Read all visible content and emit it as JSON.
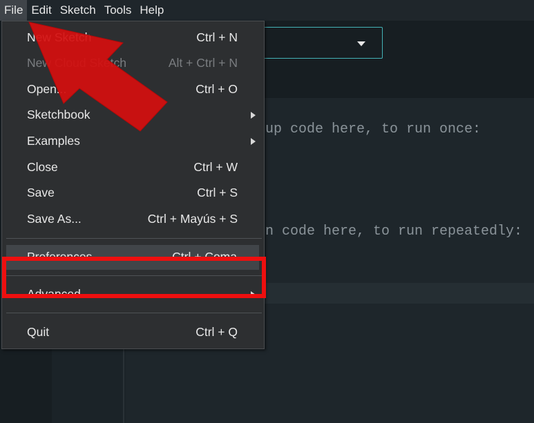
{
  "menubar": {
    "items": [
      "File",
      "Edit",
      "Sketch",
      "Tools",
      "Help"
    ]
  },
  "editor": {
    "line1": "up code here, to run once:",
    "line2": "n code here, to run repeatedly:"
  },
  "file_menu": {
    "items": [
      {
        "label": "New Sketch",
        "shortcut": "Ctrl + N"
      },
      {
        "label": "New Cloud Sketch",
        "shortcut": "Alt + Ctrl + N"
      },
      {
        "label": "Open...",
        "shortcut": "Ctrl + O"
      },
      {
        "label": "Sketchbook",
        "shortcut": ""
      },
      {
        "label": "Examples",
        "shortcut": ""
      },
      {
        "label": "Close",
        "shortcut": "Ctrl + W"
      },
      {
        "label": "Save",
        "shortcut": "Ctrl + S"
      },
      {
        "label": "Save As...",
        "shortcut": "Ctrl + Mayús + S"
      },
      {
        "label": "Preferences...",
        "shortcut": "Ctrl + Coma"
      },
      {
        "label": "Advanced",
        "shortcut": ""
      },
      {
        "label": "Quit",
        "shortcut": "Ctrl + Q"
      }
    ]
  },
  "colors": {
    "accent_annotation": "#ee0f0f",
    "select_border": "#44b3b7"
  }
}
